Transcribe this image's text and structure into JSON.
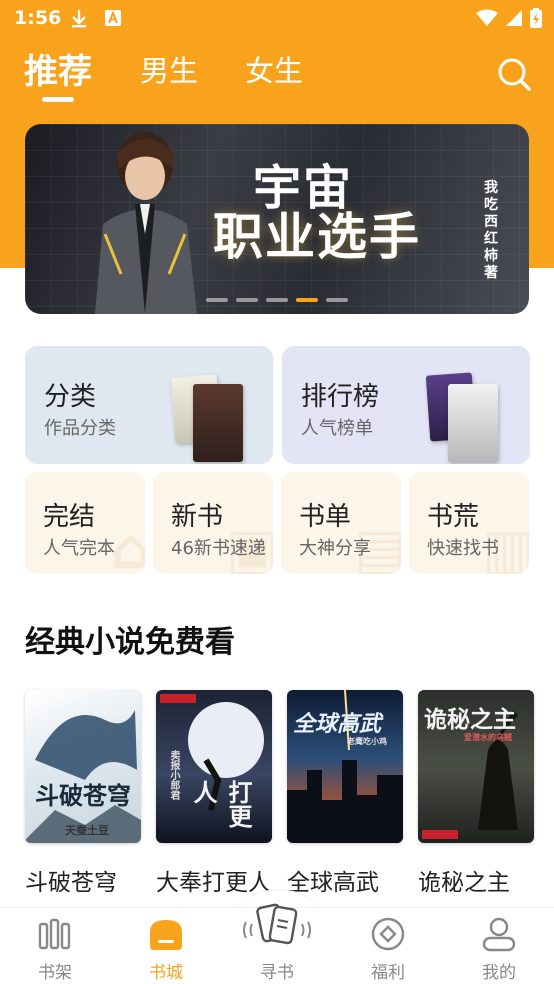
{
  "status_bar": {
    "time": "1:56"
  },
  "tabs": [
    {
      "label": "推荐",
      "active": true
    },
    {
      "label": "男生",
      "active": false
    },
    {
      "label": "女生",
      "active": false
    }
  ],
  "banner": {
    "title_line1": "宇宙",
    "title_line2": "职业选手",
    "author": "我吃西红柿著",
    "slides_count": 5,
    "active_slide": 4
  },
  "categories": {
    "big": [
      {
        "title": "分类",
        "subtitle": "作品分类"
      },
      {
        "title": "排行榜",
        "subtitle": "人气榜单"
      }
    ],
    "small": [
      {
        "title": "完结",
        "subtitle": "人气完本"
      },
      {
        "title": "新书",
        "subtitle": "46新书速递"
      },
      {
        "title": "书单",
        "subtitle": "大神分享"
      },
      {
        "title": "书荒",
        "subtitle": "快速找书"
      }
    ]
  },
  "section": {
    "title": "经典小说免费看"
  },
  "books": [
    {
      "name": "斗破苍穹",
      "cover_text": "斗破苍穹",
      "cover_author": "天蚕土豆"
    },
    {
      "name": "大奉打更人",
      "cover_text": "打更人",
      "cover_author": "卖报小郎君"
    },
    {
      "name": "全球高武",
      "cover_text": "全球高武",
      "cover_author": "老鹰吃小鸡"
    },
    {
      "name": "诡秘之主",
      "cover_text": "诡秘之主",
      "cover_author": "爱潜水的乌贼"
    }
  ],
  "bottom_nav": [
    {
      "label": "书架",
      "icon": "bookshelf-icon",
      "active": false
    },
    {
      "label": "书城",
      "icon": "bookstore-icon",
      "active": true
    },
    {
      "label": "寻书",
      "icon": "find-book-icon",
      "active": false
    },
    {
      "label": "福利",
      "icon": "welfare-icon",
      "active": false
    },
    {
      "label": "我的",
      "icon": "profile-icon",
      "active": false
    }
  ],
  "colors": {
    "accent": "#f9a21c",
    "card_blue": "#dfe8f1",
    "card_purple": "#e3e4f5",
    "card_cream": "#fbf5ea"
  }
}
